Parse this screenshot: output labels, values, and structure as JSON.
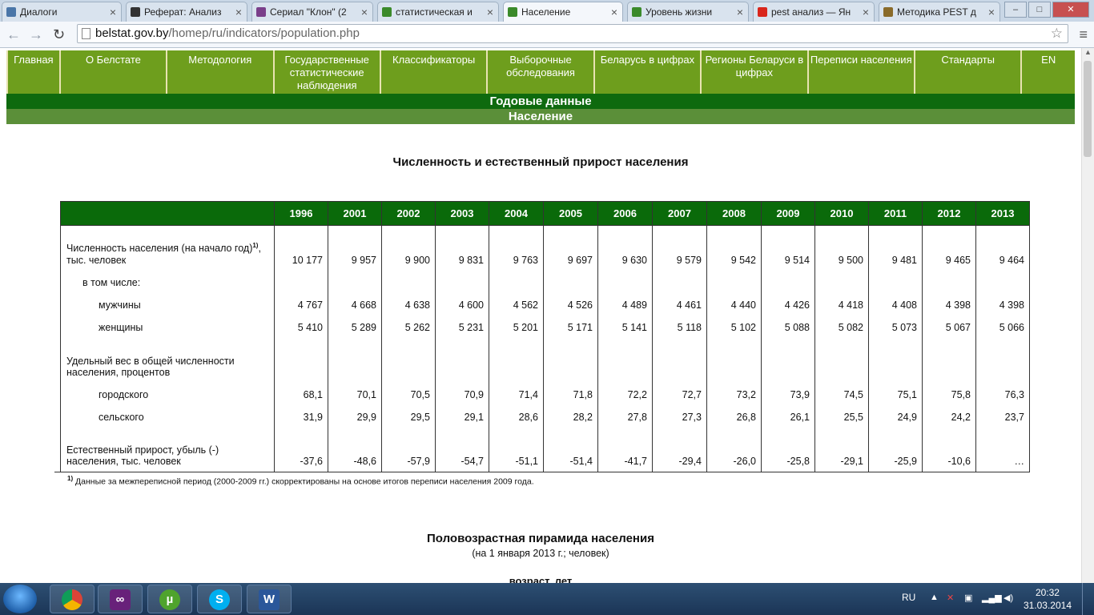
{
  "browser": {
    "tabs": [
      {
        "label": "Диалоги",
        "color": "#4a76a8"
      },
      {
        "label": "Реферат: Анализ",
        "color": "#333333"
      },
      {
        "label": "Сериал \"Клон\" (2",
        "color": "#7a3f8a"
      },
      {
        "label": "статистическая и",
        "color": "#3b8a2a"
      },
      {
        "label": "Население",
        "color": "#3b8a2a"
      },
      {
        "label": "Уровень жизни",
        "color": "#3b8a2a"
      },
      {
        "label": "pest анализ — Ян",
        "color": "#d9261c"
      },
      {
        "label": "Методика PEST д",
        "color": "#8a6b2a"
      }
    ],
    "active_tab": 4,
    "url_host": "belstat.gov.by",
    "url_path": "/homep/ru/indicators/population.php"
  },
  "site_nav": [
    "Главная",
    "О Белстате",
    "Методология",
    "Государственные статистические наблюдения",
    "Классификаторы",
    "Выборочные обследования",
    "Беларусь в цифрах",
    "Регионы Беларуси в цифрах",
    "Переписи населения",
    "Стандарты",
    "EN"
  ],
  "bars": {
    "annual": "Годовые данные",
    "population": "Население"
  },
  "table_title": "Численность и естественный прирост населения",
  "table": {
    "years": [
      "1996",
      "2001",
      "2002",
      "2003",
      "2004",
      "2005",
      "2006",
      "2007",
      "2008",
      "2009",
      "2010",
      "2011",
      "2012",
      "2013"
    ],
    "rows": [
      {
        "label": "Численность населения (на начало год)",
        "note": "1)",
        "label_tail": ", тыс. человек",
        "indent": 0,
        "tall": true,
        "values": [
          "10 177",
          "9 957",
          "9 900",
          "9 831",
          "9 763",
          "9 697",
          "9 630",
          "9 579",
          "9 542",
          "9 514",
          "9 500",
          "9 481",
          "9 465",
          "9 464"
        ]
      },
      {
        "label": "в том числе:",
        "indent": 1,
        "values": []
      },
      {
        "label": "мужчины",
        "indent": 2,
        "values": [
          "4 767",
          "4 668",
          "4 638",
          "4 600",
          "4 562",
          "4 526",
          "4 489",
          "4 461",
          "4 440",
          "4 426",
          "4 418",
          "4 408",
          "4 398",
          "4 398"
        ]
      },
      {
        "label": "женщины",
        "indent": 2,
        "values": [
          "5 410",
          "5 289",
          "5 262",
          "5 231",
          "5 201",
          "5 171",
          "5 141",
          "5 118",
          "5 102",
          "5 088",
          "5 082",
          "5 073",
          "5 067",
          "5 066"
        ]
      },
      {
        "label": "Удельный вес в общей численности населения, процентов",
        "indent": 0,
        "values": []
      },
      {
        "label": "городского",
        "indent": 2,
        "values": [
          "68,1",
          "70,1",
          "70,5",
          "70,9",
          "71,4",
          "71,8",
          "72,2",
          "72,7",
          "73,2",
          "73,9",
          "74,5",
          "75,1",
          "75,8",
          "76,3"
        ]
      },
      {
        "label": "сельского",
        "indent": 2,
        "values": [
          "31,9",
          "29,9",
          "29,5",
          "29,1",
          "28,6",
          "28,2",
          "27,8",
          "27,3",
          "26,8",
          "26,1",
          "25,5",
          "24,9",
          "24,2",
          "23,7"
        ]
      },
      {
        "label": "Естественный прирост, убыль (-) населения, тыс. человек",
        "indent": 0,
        "last": true,
        "values": [
          "-37,6",
          "-48,6",
          "-57,9",
          "-54,7",
          "-51,1",
          "-51,4",
          "-41,7",
          "-29,4",
          "-26,0",
          "-25,8",
          "-29,1",
          "-25,9",
          "-10,6",
          "…"
        ]
      }
    ]
  },
  "footnote": {
    "mark": "1)",
    "text": "Данные за межпереписной период (2000-2009 гг.) скорректированы на основе итогов переписи населения 2009 года."
  },
  "pyramid_title": "Половозрастная пирамида населения",
  "pyramid_subtitle": "(на 1 января 2013 г.; человек)",
  "pyramid_axis_cut": "возраст, лет",
  "taskbar": {
    "apps": [
      "chrome-icon",
      "visual-studio-icon",
      "utorrent-icon",
      "skype-icon",
      "word-icon"
    ],
    "lang": "RU",
    "time": "20:32",
    "date": "31.03.2014"
  }
}
